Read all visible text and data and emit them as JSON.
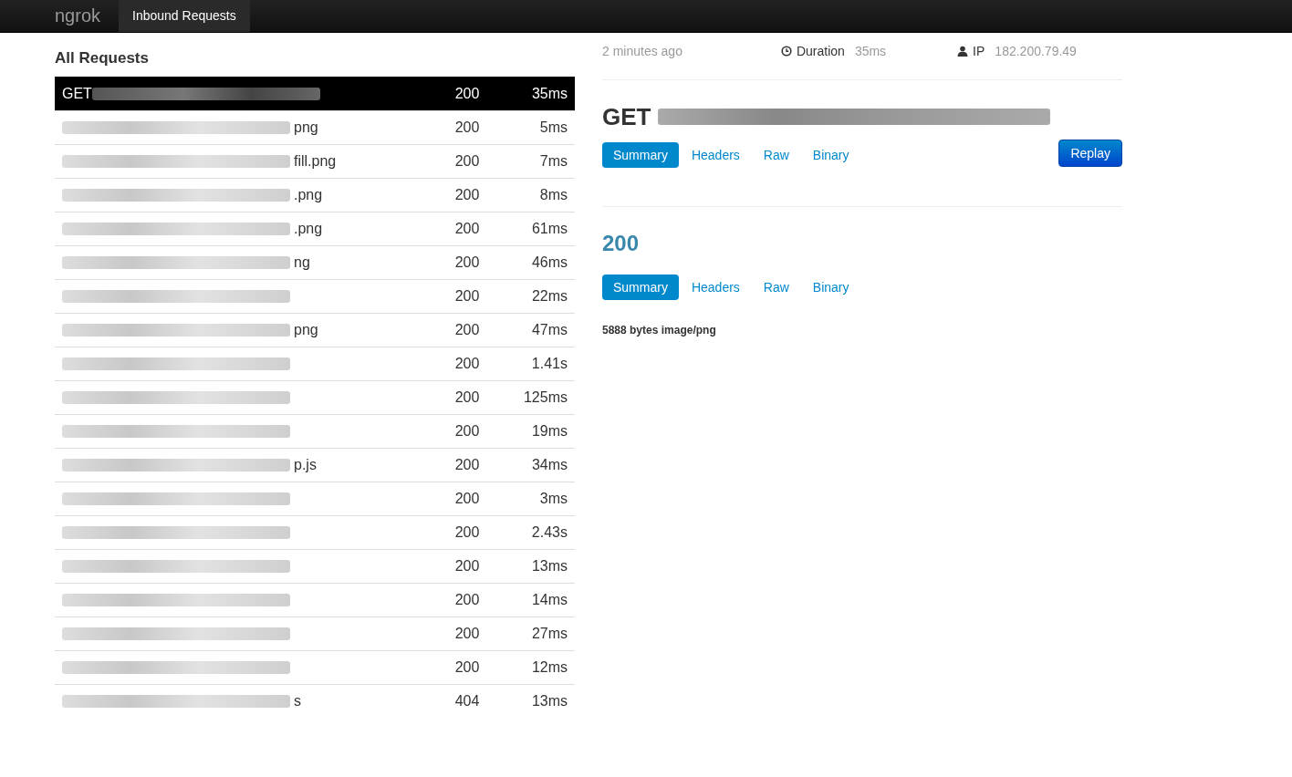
{
  "navbar": {
    "brand": "ngrok",
    "tabs": [
      {
        "label": "Inbound Requests",
        "selected": true
      }
    ]
  },
  "requests": {
    "title": "All Requests",
    "rows": [
      {
        "method": "GET",
        "redacted": true,
        "tail": "",
        "status": "200",
        "duration": "35ms",
        "selected": true
      },
      {
        "method": "",
        "redacted": true,
        "tail": "png",
        "status": "200",
        "duration": "5ms",
        "selected": false
      },
      {
        "method": "",
        "redacted": true,
        "tail": "fill.png",
        "status": "200",
        "duration": "7ms",
        "selected": false
      },
      {
        "method": "",
        "redacted": true,
        "tail": ".png",
        "status": "200",
        "duration": "8ms",
        "selected": false
      },
      {
        "method": "",
        "redacted": true,
        "tail": ".png",
        "status": "200",
        "duration": "61ms",
        "selected": false
      },
      {
        "method": "",
        "redacted": true,
        "tail": "ng",
        "status": "200",
        "duration": "46ms",
        "selected": false
      },
      {
        "method": "",
        "redacted": true,
        "tail": "",
        "status": "200",
        "duration": "22ms",
        "selected": false
      },
      {
        "method": "",
        "redacted": true,
        "tail": "png",
        "status": "200",
        "duration": "47ms",
        "selected": false
      },
      {
        "method": "",
        "redacted": true,
        "tail": "",
        "status": "200",
        "duration": "1.41s",
        "selected": false
      },
      {
        "method": "",
        "redacted": true,
        "tail": "",
        "status": "200",
        "duration": "125ms",
        "selected": false
      },
      {
        "method": "",
        "redacted": true,
        "tail": "",
        "status": "200",
        "duration": "19ms",
        "selected": false
      },
      {
        "method": "",
        "redacted": true,
        "tail": "p.js",
        "status": "200",
        "duration": "34ms",
        "selected": false
      },
      {
        "method": "",
        "redacted": true,
        "tail": "",
        "status": "200",
        "duration": "3ms",
        "selected": false
      },
      {
        "method": "",
        "redacted": true,
        "tail": "",
        "status": "200",
        "duration": "2.43s",
        "selected": false
      },
      {
        "method": "",
        "redacted": true,
        "tail": "",
        "status": "200",
        "duration": "13ms",
        "selected": false
      },
      {
        "method": "",
        "redacted": true,
        "tail": "",
        "status": "200",
        "duration": "14ms",
        "selected": false
      },
      {
        "method": "",
        "redacted": true,
        "tail": "",
        "status": "200",
        "duration": "27ms",
        "selected": false
      },
      {
        "method": "",
        "redacted": true,
        "tail": "",
        "status": "200",
        "duration": "12ms",
        "selected": false
      },
      {
        "method": "",
        "redacted": true,
        "tail": "s",
        "status": "404",
        "duration": "13ms",
        "selected": false
      }
    ]
  },
  "detail": {
    "time": "2 minutes ago",
    "duration_label": "Duration",
    "duration": "35ms",
    "ip_label": "IP",
    "ip": "182.200.79.49",
    "request": {
      "method": "GET",
      "redacted": true,
      "tabs": [
        {
          "label": "Summary",
          "selected": true
        },
        {
          "label": "Headers",
          "selected": false
        },
        {
          "label": "Raw",
          "selected": false
        },
        {
          "label": "Binary",
          "selected": false
        }
      ],
      "replay": "Replay"
    },
    "response": {
      "status": "200",
      "tabs": [
        {
          "label": "Summary",
          "selected": true
        },
        {
          "label": "Headers",
          "selected": false
        },
        {
          "label": "Raw",
          "selected": false
        },
        {
          "label": "Binary",
          "selected": false
        }
      ],
      "summary": "5888 bytes image/png"
    }
  }
}
